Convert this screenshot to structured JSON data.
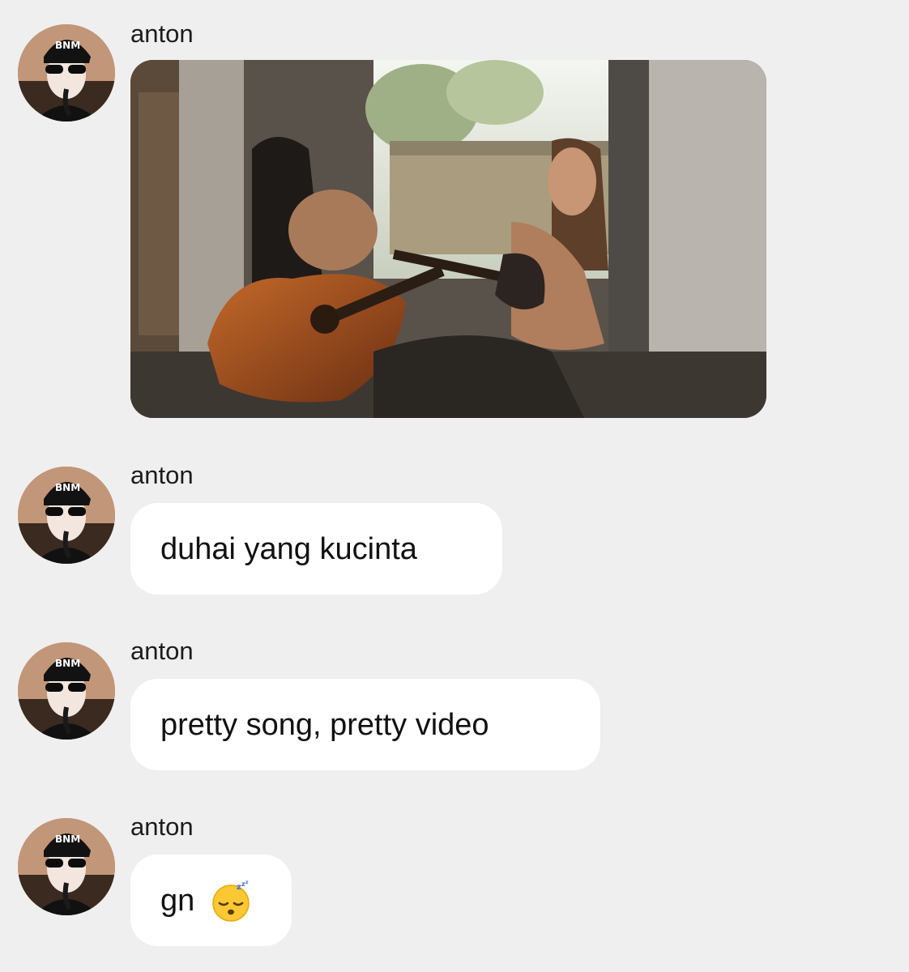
{
  "messages": [
    {
      "sender": "anton",
      "type": "image",
      "image_alt": "two women playing guitars in a doorway"
    },
    {
      "sender": "anton",
      "type": "text",
      "text": "duhai yang kucinta"
    },
    {
      "sender": "anton",
      "type": "text",
      "text": "pretty song, pretty video"
    },
    {
      "sender": "anton",
      "type": "text",
      "text": "gn",
      "emoji": "sleeping-face-emoji"
    }
  ],
  "colors": {
    "background": "#efefef",
    "bubble": "#ffffff",
    "text": "#111111"
  }
}
